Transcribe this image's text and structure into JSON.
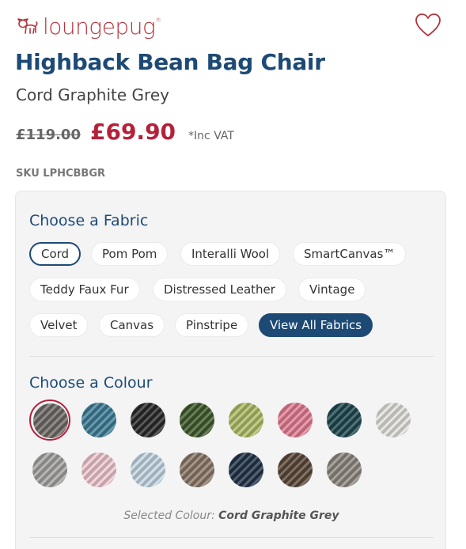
{
  "brand": {
    "name": "loungepug",
    "reg": "®",
    "logo_icon": "pug-icon",
    "color": "#b5343c"
  },
  "wishlist": {
    "icon": "heart-icon"
  },
  "product": {
    "title": "Highback Bean Bag Chair",
    "subtitle": "Cord Graphite Grey",
    "old_price": "£119.00",
    "price": "£69.90",
    "vat_note": "*Inc VAT",
    "sku": "SKU LPHCBBGR"
  },
  "fabric": {
    "heading": "Choose a Fabric",
    "options": [
      {
        "label": "Cord",
        "state": "selected"
      },
      {
        "label": "Pom Pom"
      },
      {
        "label": "Interalli Wool"
      },
      {
        "label": "SmartCanvas™"
      },
      {
        "label": "Teddy Faux Fur"
      },
      {
        "label": "Distressed Leather"
      },
      {
        "label": "Vintage"
      },
      {
        "label": "Velvet"
      },
      {
        "label": "Canvas"
      },
      {
        "label": "Pinstripe"
      },
      {
        "label": "View All Fabrics",
        "state": "primary"
      }
    ]
  },
  "colour": {
    "heading": "Choose a Colour",
    "swatches": [
      {
        "color": "#6e6a66",
        "selected": true
      },
      {
        "color": "#3f7e96"
      },
      {
        "color": "#2a2a2a"
      },
      {
        "color": "#3f5a2c"
      },
      {
        "color": "#aebd66"
      },
      {
        "color": "#e27d92"
      },
      {
        "color": "#1f4850"
      },
      {
        "color": "#e2e0dc"
      },
      {
        "color": "#a4a3a2"
      },
      {
        "color": "#eec8d0"
      },
      {
        "color": "#c3d6e3"
      },
      {
        "color": "#8a7868"
      },
      {
        "color": "#223449"
      },
      {
        "color": "#5a4838"
      },
      {
        "color": "#8e8880"
      }
    ],
    "selected_label": "Selected Colour:",
    "selected_value": "Cord Graphite Grey"
  },
  "colors": {
    "navy": "#1d4a75",
    "sale_red": "#b5203a"
  }
}
